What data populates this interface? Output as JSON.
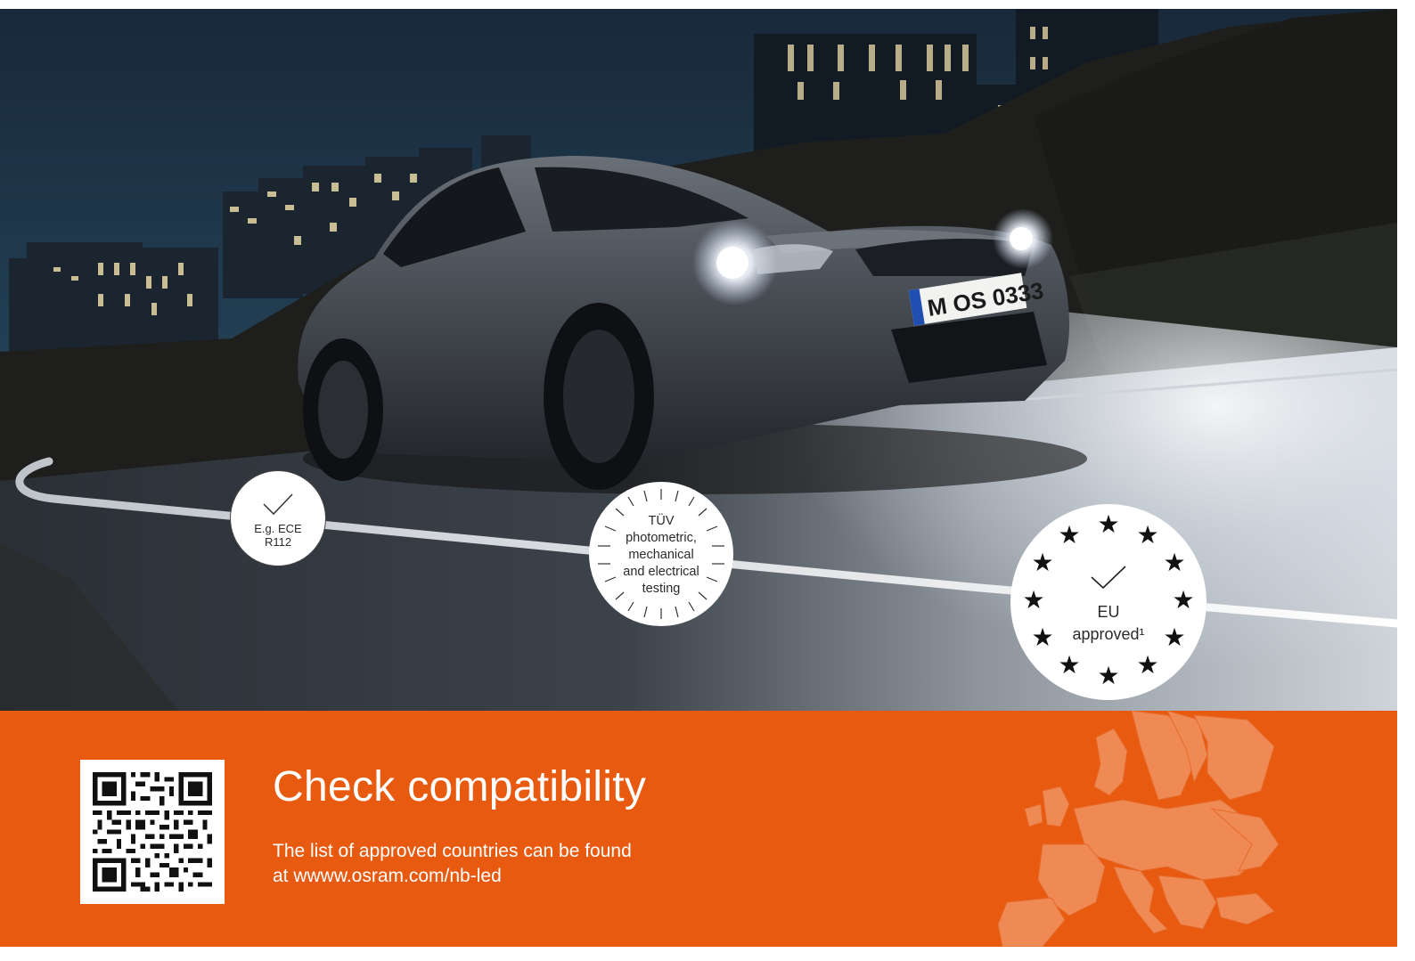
{
  "badges": {
    "ece": {
      "line1": "E.g. ECE",
      "line2": "R112"
    },
    "tuv": {
      "line1": "TÜV",
      "line2": "photometric,",
      "line3": "mechanical",
      "line4": "and electrical",
      "line5": "testing"
    },
    "eu": {
      "line1": "EU",
      "line2": "approved¹"
    }
  },
  "license_plate": {
    "text": "M OS 0333"
  },
  "info_panel": {
    "headline": "Check compatibility",
    "line1": "The list of approved countries can be found",
    "line2": "at wwww.osram.com/nb-led"
  },
  "icons": {
    "qr": "qr-code-icon",
    "map": "europe-map-icon",
    "check": "checkmark-icon",
    "star": "star-icon"
  },
  "colors": {
    "brand_orange": "#e85a0f",
    "sky": "#1d3347",
    "road": "#3a3e44"
  }
}
